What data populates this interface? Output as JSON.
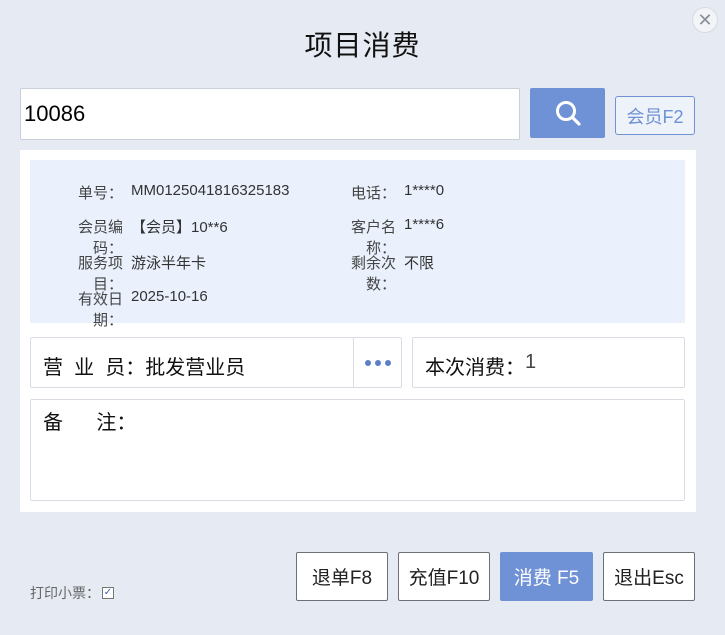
{
  "dialog": {
    "title": "项目消费",
    "close_icon": "close-icon"
  },
  "search": {
    "value": "10086",
    "search_icon": "search-icon",
    "member_button": "会员F2"
  },
  "info": {
    "order_no_label": "单号：",
    "order_no": "MM0125041816325183",
    "phone_label": "电话：",
    "phone": "1****0",
    "member_code_label": "会员编码：",
    "member_code": "【会员】10**6",
    "customer_name_label": "客户名称：",
    "customer_name": "1****6",
    "service_label": "服务项目：",
    "service": "游泳半年卡",
    "remaining_label": "剩余次数：",
    "remaining": "不限",
    "expiry_label": "有效日期：",
    "expiry": "2025-10-16"
  },
  "staff": {
    "label": "营  业  员：",
    "value": "批发营业员"
  },
  "consume": {
    "label": "本次消费：",
    "value": "1"
  },
  "remark": {
    "label": "备      注：",
    "value": ""
  },
  "print": {
    "label": "打印小票：",
    "checked": true
  },
  "buttons": {
    "refund": "退单F8",
    "recharge": "充值F10",
    "consume": "消费 F5",
    "exit": "退出Esc"
  },
  "colors": {
    "accent": "#6f91d6",
    "background": "#e6ebf3",
    "info_bg": "#eaf1fd"
  }
}
